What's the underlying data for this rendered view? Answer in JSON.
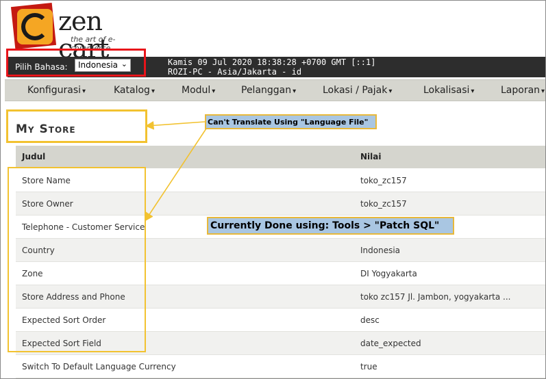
{
  "logo": {
    "wordmark": "zen cart",
    "tagline": "the art of e-commerce"
  },
  "header": {
    "language_label": "Pilih Bahasa:",
    "language_value": "Indonesia",
    "status_line1": "Kamis 09 Jul 2020 18:38:28 +0700 GMT [::1]",
    "status_line2": "ROZI-PC - Asia/Jakarta - id"
  },
  "menu": [
    {
      "label": "Konfigurasi"
    },
    {
      "label": "Katalog"
    },
    {
      "label": "Modul"
    },
    {
      "label": "Pelanggan"
    },
    {
      "label": "Lokasi / Pajak"
    },
    {
      "label": "Lokalisasi"
    },
    {
      "label": "Laporan"
    }
  ],
  "page": {
    "title": "My Store"
  },
  "callouts": {
    "language_file": "Can't Translate Using \"Language File\"",
    "patch_sql": "Currently Done using: Tools > \"Patch SQL\""
  },
  "table": {
    "headers": [
      "Judul",
      "Nilai"
    ],
    "rows": [
      {
        "title": "Store Name",
        "value": "toko_zc157"
      },
      {
        "title": "Store Owner",
        "value": "toko_zc157"
      },
      {
        "title": "Telephone - Customer Service",
        "value": ""
      },
      {
        "title": "Country",
        "value": "Indonesia"
      },
      {
        "title": "Zone",
        "value": "DI Yogyakarta"
      },
      {
        "title": "Store Address and Phone",
        "value": "toko zc157 Jl. Jambon, yogyakarta ..."
      },
      {
        "title": "Expected Sort Order",
        "value": "desc"
      },
      {
        "title": "Expected Sort Field",
        "value": "date_expected"
      },
      {
        "title": "Switch To Default Language Currency",
        "value": "true"
      }
    ]
  },
  "colors": {
    "annotation_red": "#e8141a",
    "annotation_yellow": "#f2c230",
    "callout_blue": "#a9c6e2",
    "topbar": "#2d2d2d",
    "menubar": "#d6d6cf"
  }
}
